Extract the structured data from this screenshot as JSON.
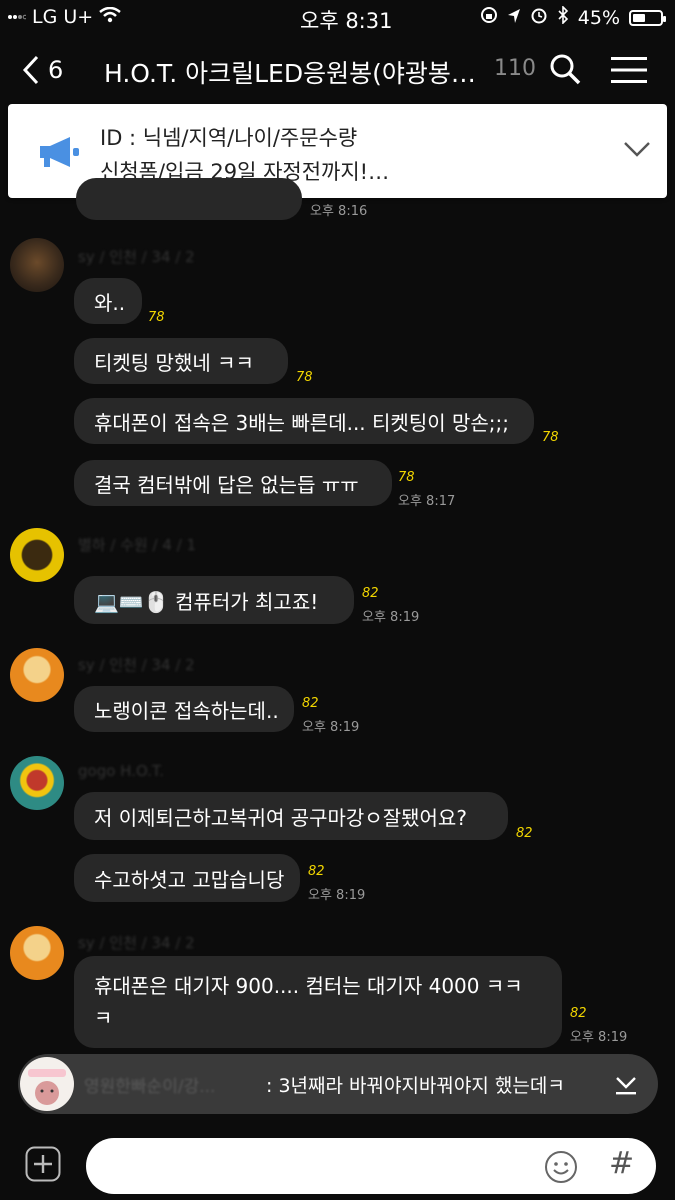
{
  "status": {
    "carrier": "LG U+",
    "time": "오후 8:31",
    "battery": "45%",
    "battery_level": 0.45
  },
  "header": {
    "back_count": "6",
    "title": "H.O.T. 아크릴LED응원봉(야광봉…",
    "member_count": "110"
  },
  "notice": {
    "line1": "ID : 닉넴/지역/나이/주문수량",
    "line2": "신청폼/입금 29일 자정전까지!…"
  },
  "messages": [
    {
      "text": "와..",
      "unread": "78"
    },
    {
      "text": "티켓팅 망했네 ㅋㅋ",
      "unread": "78"
    },
    {
      "text": "휴대폰이 접속은 3배는 빠른데... 티켓팅이 망손;;;",
      "unread": "78"
    },
    {
      "text": "결국 컴터밖에 답은 없는듭 ㅠㅠ",
      "unread": "78",
      "time": "오후 8:17"
    },
    {
      "text": "💻⌨️🖱️ 컴퓨터가 최고죠!",
      "unread": "82",
      "time": "오후 8:19"
    },
    {
      "text": "노랭이콘 접속하는데..",
      "unread": "82",
      "time": "오후 8:19"
    },
    {
      "text": "저 이제퇴근하고복귀여  공구마강ㅇ잘됐어요?",
      "unread": "82"
    },
    {
      "text": "수고하셧고 고맙습니당",
      "unread": "82",
      "time": "오후 8:19"
    },
    {
      "text": "휴대폰은 대기자 900.... 컴터는 대기자 4000 ㅋㅋ ㅋ",
      "unread": "82",
      "time": "오후 8:19"
    }
  ],
  "earlier_time": "오후 8:16",
  "preview": {
    "text": ": 3년째라 바꿔야지바꿔야지 했는데ㅋ"
  },
  "input": {
    "placeholder": ""
  },
  "colors": {
    "background": "#0c0c0c",
    "bubble": "#282828",
    "unread": "#f2d600",
    "notice_icon": "#4a90e2"
  },
  "icons": [
    "back-chevron-icon",
    "search-icon",
    "menu-icon",
    "megaphone-icon",
    "chevron-down-icon",
    "plus-icon",
    "emoji-icon",
    "hash-icon",
    "wifi-icon",
    "battery-icon"
  ]
}
